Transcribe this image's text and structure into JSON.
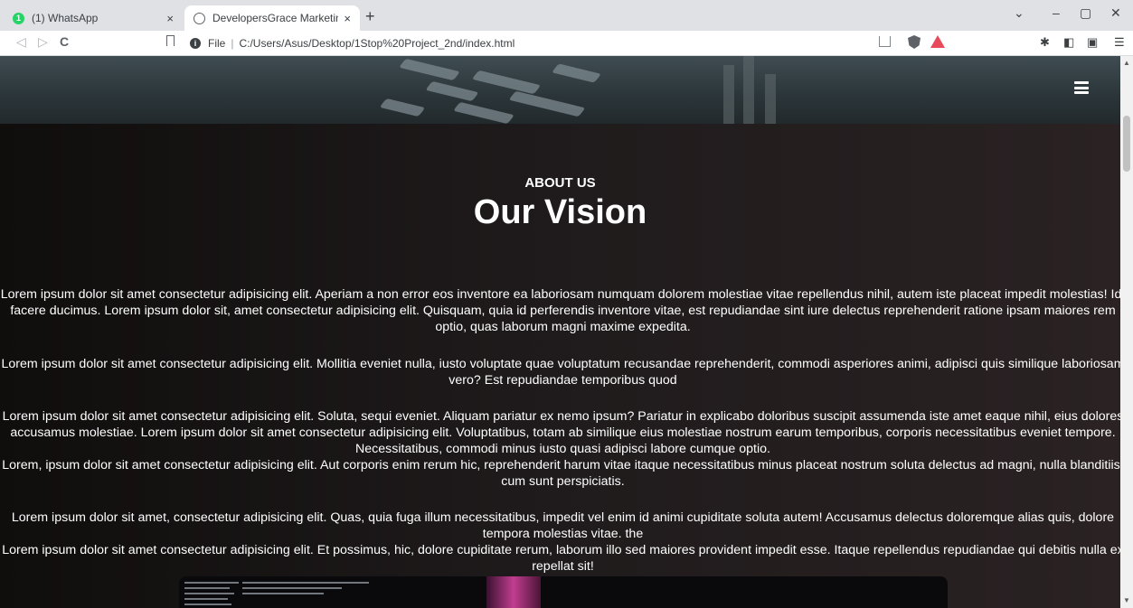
{
  "browser": {
    "tabs": [
      {
        "title": "(1) WhatsApp",
        "badge": "1",
        "active": false
      },
      {
        "title": "DevelopersGrace Marketing and",
        "active": true
      }
    ],
    "new_tab_symbol": "+",
    "close_symbol": "×",
    "window_controls": {
      "minimize": "–",
      "maximize": "▢",
      "close": "✕",
      "tab_search": "⌄"
    },
    "nav": {
      "back": "◁",
      "forward": "▷",
      "reload": "C"
    },
    "address": {
      "scheme_label": "File",
      "separator": "|",
      "url": "C:/Users/Asus/Desktop/1Stop%20Project_2nd/index.html",
      "info_symbol": "i"
    },
    "extension_icons": [
      "share-icon",
      "brave-shield-icon",
      "brave-rewards-icon",
      "extensions-icon",
      "sidebar-icon",
      "wallet-icon",
      "menu-icon"
    ],
    "right_icons": {
      "extensions": "✱",
      "sidebar": "◧",
      "wallet": "▣",
      "menu": "☰"
    },
    "scroll": {
      "up": "▲",
      "down": "▼"
    }
  },
  "page": {
    "about_label": "ABOUT US",
    "title": "Our Vision",
    "paragraphs": [
      [
        "Lorem ipsum dolor sit amet consectetur adipisicing elit. Aperiam a non error eos inventore ea laboriosam numquam dolorem molestiae vitae repellendus nihil, autem iste placeat impedit molestias! Id, facere ducimus. Lorem ipsum dolor sit, amet consectetur adipisicing elit. Quisquam, quia id perferendis inventore vitae, est repudiandae sint iure delectus reprehenderit ratione ipsam maiores rem optio, quas laborum magni maxime expedita."
      ],
      [
        "Lorem ipsum dolor sit amet consectetur adipisicing elit. Mollitia eveniet nulla, iusto voluptate quae voluptatum recusandae reprehenderit, commodi asperiores animi, adipisci quis similique laboriosam vero? Est repudiandae temporibus quod"
      ],
      [
        "Lorem ipsum dolor sit amet consectetur adipisicing elit. Soluta, sequi eveniet. Aliquam pariatur ex nemo ipsum? Pariatur in explicabo doloribus suscipit assumenda iste amet eaque nihil, eius dolores accusamus molestiae. Lorem ipsum dolor sit amet consectetur adipisicing elit. Voluptatibus, totam ab similique eius molestiae nostrum earum temporibus, corporis necessitatibus eveniet tempore. Necessitatibus, commodi minus iusto quasi adipisci labore cumque optio.",
        "Lorem, ipsum dolor sit amet consectetur adipisicing elit. Aut corporis enim rerum hic, reprehenderit harum vitae itaque necessitatibus minus placeat nostrum soluta delectus ad magni, nulla blanditiis, cum sunt perspiciatis."
      ],
      [
        "Lorem ipsum dolor sit amet, consectetur adipisicing elit. Quas, quia fuga illum necessitatibus, impedit vel enim id animi cupiditate soluta autem! Accusamus delectus doloremque alias quis, dolore tempora molestias vitae. the",
        "Lorem ipsum dolor sit amet consectetur adipisicing elit. Et possimus, hic, dolore cupiditate rerum, laborum illo sed maiores provident impedit esse. Itaque repellendus repudiandae qui debitis nulla ex repellat sit!"
      ]
    ]
  },
  "colors": {
    "accent_pink": "#c13d8f",
    "page_bg": "#1b1718",
    "text": "#ffffff",
    "whatsapp": "#25d366",
    "brave_rewards": "#e64a5b"
  }
}
